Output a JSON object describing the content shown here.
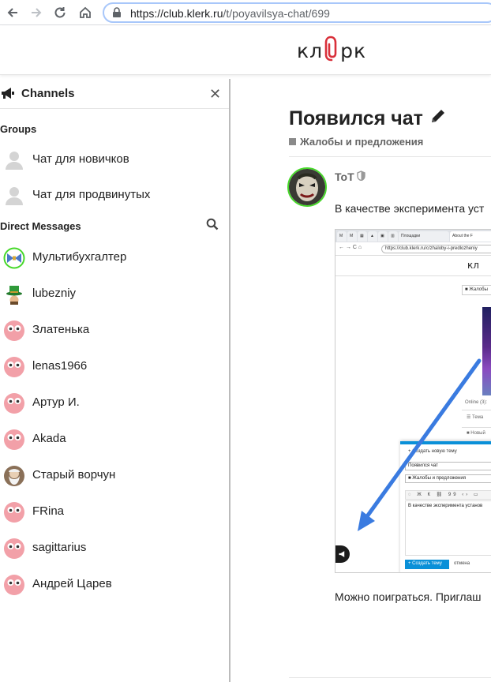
{
  "browser": {
    "url_host": "https://club.klerk.ru",
    "url_path": "/t/poyavilsya-chat/699"
  },
  "site": {
    "logo_left": "кл",
    "logo_right": "рк"
  },
  "sidebar": {
    "title": "Channels",
    "groups_title": "Groups",
    "groups": [
      {
        "label": "Чат для новичков"
      },
      {
        "label": "Чат для продвинутых"
      }
    ],
    "dm_title": "Direct Messages",
    "dms": [
      {
        "label": "Мультибухгалтер"
      },
      {
        "label": "lubezniy"
      },
      {
        "label": "Златенька"
      },
      {
        "label": "lenas1966"
      },
      {
        "label": "Артур И."
      },
      {
        "label": "Akada"
      },
      {
        "label": "Старый ворчун"
      },
      {
        "label": "FRina"
      },
      {
        "label": "sagittarius"
      },
      {
        "label": "Андрей Царев"
      }
    ]
  },
  "topic": {
    "title": "Появился чат",
    "category": "Жалобы и предложения",
    "username": "ToT",
    "text1": "В качестве эксперимента уст",
    "text2": "Можно поиграться. Приглаш"
  },
  "embedded": {
    "tab1": "Площадки",
    "tab2": "About the F",
    "url": "https://club.klerk.ru/c/zhaloby-i-predlozheniy",
    "logo": "кл",
    "category": "Жалобы",
    "online": "Online (3):",
    "tema": "Тема",
    "new": "Новый",
    "composer_title": "Создать новую тему",
    "composer_topic": "Появился чат",
    "composer_category": "Жалобы и предложения",
    "toolbar": "Ж К",
    "editor_text": "В качестве эксперимента установ",
    "create_btn": "Создать тему",
    "cancel": "отмена"
  },
  "colors": {
    "online_ring": "#47d82a",
    "accent_blue": "#0a90d8",
    "arrow_blue": "#3a7be0",
    "avatar_pink": "#f2a0a8"
  }
}
